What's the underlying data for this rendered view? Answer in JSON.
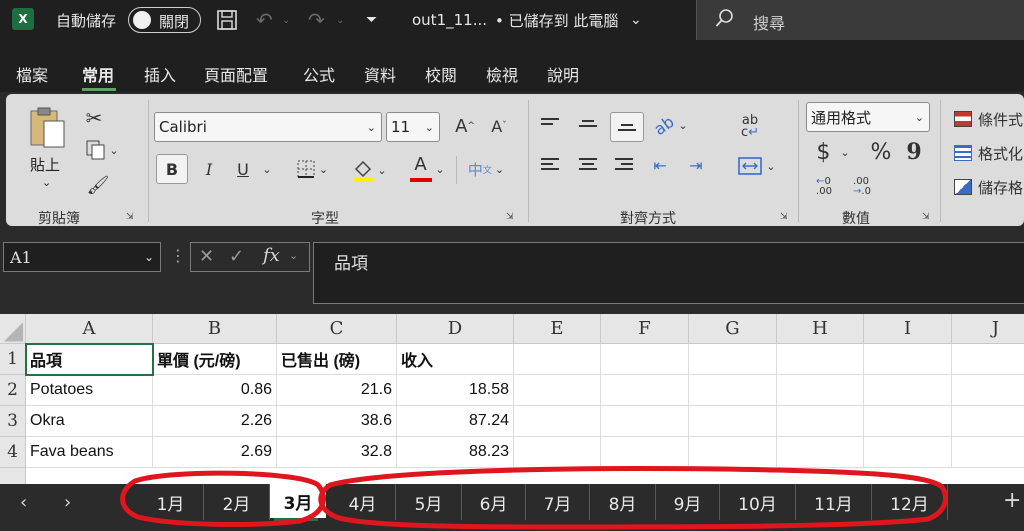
{
  "titlebar": {
    "app_icon": "X",
    "autosave_label": "自動儲存",
    "toggle_state": "關閉",
    "filename": "out1_11...",
    "save_status": "• 已儲存到 此電腦",
    "search_placeholder": "搜尋"
  },
  "menu": {
    "tabs": [
      {
        "label": "檔案"
      },
      {
        "label": "常用",
        "active": true
      },
      {
        "label": "插入"
      },
      {
        "label": "頁面配置"
      },
      {
        "label": "公式"
      },
      {
        "label": "資料"
      },
      {
        "label": "校閱"
      },
      {
        "label": "檢視"
      },
      {
        "label": "說明"
      }
    ]
  },
  "ribbon": {
    "clipboard": {
      "label": "剪貼簿",
      "paste_label": "貼上"
    },
    "font": {
      "label": "字型",
      "font_name": "Calibri",
      "font_size": "11",
      "bold": "B",
      "italic": "I",
      "underline": "U",
      "phonetic": "中"
    },
    "alignment": {
      "label": "對齊方式"
    },
    "number": {
      "label": "數值",
      "format": "通用格式",
      "currency": "$",
      "percent": "%",
      "comma": "9"
    },
    "styles": {
      "items": [
        "條件式",
        "格式化",
        "儲存格"
      ]
    }
  },
  "formula_bar": {
    "name_box": "A1",
    "formula": "品項"
  },
  "grid": {
    "columns": [
      "A",
      "B",
      "C",
      "D",
      "E",
      "F",
      "G",
      "H",
      "I",
      "J"
    ],
    "rows": [
      "1",
      "2",
      "3",
      "4"
    ],
    "headers": [
      "品項",
      "單價 (元/磅)",
      "已售出 (磅)",
      "收入"
    ],
    "data": [
      [
        "Potatoes",
        "0.86",
        "21.6",
        "18.58"
      ],
      [
        "Okra",
        "2.26",
        "38.6",
        "87.24"
      ],
      [
        "Fava beans",
        "2.69",
        "32.8",
        "88.23"
      ]
    ]
  },
  "sheets": {
    "tabs": [
      "1月",
      "2月",
      "3月",
      "4月",
      "5月",
      "6月",
      "7月",
      "8月",
      "9月",
      "10月",
      "11月",
      "12月"
    ],
    "active": "3月",
    "add_symbol": "+",
    "annotation_color": "#e0161e"
  }
}
